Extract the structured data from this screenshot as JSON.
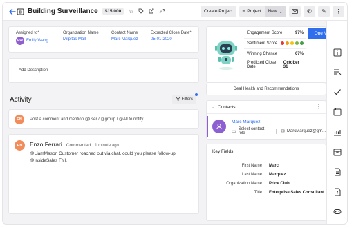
{
  "header": {
    "title": "Building Surveillance",
    "amount": "$15,000",
    "create_project_label": "Create Project",
    "project_label": "Project",
    "stage_label": "New"
  },
  "details": {
    "assigned_to_label": "Assigned to*",
    "assigned_to_initials": "EW",
    "assigned_to_value": "Emily Wang",
    "org_label": "Organization Name",
    "org_value": "Milpitas Mall",
    "contact_label": "Contact Name",
    "contact_value": "Marc Marquez",
    "close_label": "Expected Close Date*",
    "close_value": "05-01-2020",
    "add_description": "Add Description"
  },
  "activity": {
    "title": "Activity",
    "filters_label": "Filters",
    "composer_initials": "EN",
    "composer_placeholder": "Post a comment and mention @user / @group / @All to notify",
    "post": {
      "initials": "EN",
      "author": "Enzo Ferrari",
      "action": "Commented",
      "time": "1 minute ago",
      "body": "@LiamMason Customer roached out via chat, could you please follow-up. @InsideSales FYI."
    }
  },
  "scores": {
    "one_view_label": "One View",
    "rows": [
      {
        "label": "Engagement Score",
        "value": "97%"
      },
      {
        "label": "Sentiment Score",
        "value": ""
      },
      {
        "label": "Winning Chance",
        "value": "67%"
      },
      {
        "label": "Predicted Close Date",
        "value": "October 31"
      }
    ],
    "sentiment_colors": [
      "#e53935",
      "#f39c12",
      "#f1c40f",
      "#7cb342",
      "#43a047"
    ],
    "deal_health_label": "Deal Health and Recommendations"
  },
  "contacts": {
    "title": "Contacts",
    "name": "Marc Marquez",
    "role_placeholder": "Select contact role",
    "email": "MarcMarquez@gm..."
  },
  "key_fields": {
    "title": "Key Fields",
    "rows": [
      {
        "label": "First Name",
        "value": "Marc"
      },
      {
        "label": "Last Name",
        "value": "Marquez"
      },
      {
        "label": "Organization Name",
        "value": "Price Club"
      },
      {
        "label": "Title",
        "value": "Enterprise Sales Consultant"
      }
    ]
  },
  "colors": {
    "accent": "#2f6fed",
    "avatar_purple": "#8e5fd0",
    "avatar_orange": "#f28c5b"
  }
}
